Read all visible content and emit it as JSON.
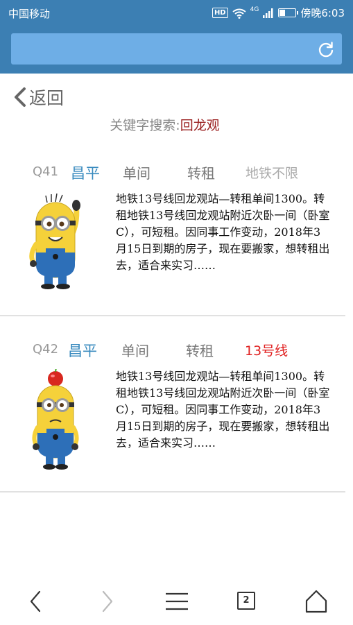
{
  "status_bar": {
    "carrier": "中国移动",
    "hd_label": "HD",
    "network_label": "4G",
    "time": "傍晚6:03",
    "battery_level": 0.4
  },
  "header": {
    "refresh_icon": "refresh-icon"
  },
  "back": {
    "label": "返回",
    "icon": "chevron-left-icon"
  },
  "search": {
    "prefix": "关键字搜索:",
    "keyword": "回龙观"
  },
  "listings": [
    {
      "code": "Q41",
      "district": "昌平",
      "room_type": "单间",
      "rent_type": "转租",
      "subway": "地铁不限",
      "subway_color": "#aaaaaa",
      "description": "地铁13号线回龙观站—转租单间1300。转租地铁13号线回龙观站附近次卧一间（卧室C），可短租。因同事工作变动，2018年3月15日到期的房子，现在要搬家，想转租出去，适合来实习……",
      "thumbnail": "minion-waving-icon"
    },
    {
      "code": "Q42",
      "district": "昌平",
      "room_type": "单间",
      "rent_type": "转租",
      "subway": "13号线",
      "subway_color": "#e02020",
      "description": "地铁13号线回龙观站—转租单间1300。转租地铁13号线回龙观站附近次卧一间（卧室C），可短租。因同事工作变动，2018年3月15日到期的房子，现在要搬家，想转租出去，适合来实习……",
      "thumbnail": "minion-apple-icon"
    }
  ],
  "bottom_nav": {
    "tab_count": "2",
    "icons": [
      "back-arrow-icon",
      "forward-arrow-icon",
      "menu-icon",
      "tabs-icon",
      "home-icon"
    ]
  },
  "colors": {
    "brand_blue": "#3c7fb3",
    "url_bar": "#6eaee6",
    "keyword": "#9b2020",
    "district": "#3a8bbf"
  }
}
